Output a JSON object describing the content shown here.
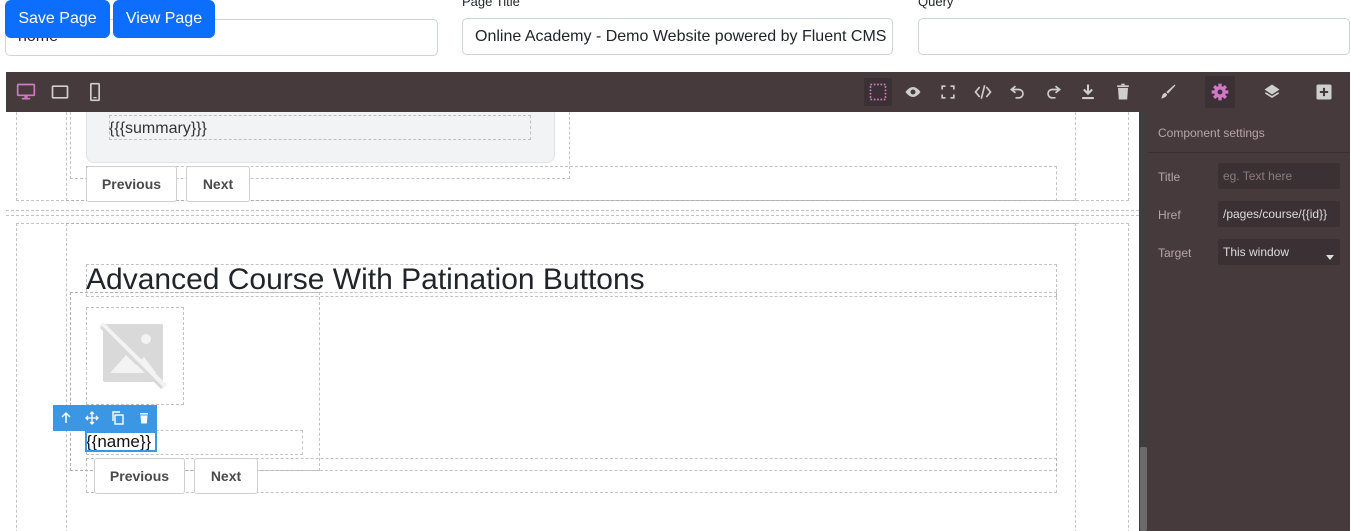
{
  "form": {
    "slug_value": "home",
    "page_title_label": "Page Title",
    "page_title_value": "Online Academy - Demo Website powered by Fluent CMS",
    "query_label": "Query",
    "query_value": ""
  },
  "actions": {
    "save_label": "Save Page",
    "view_label": "View Page"
  },
  "toolbar": {
    "devices": [
      "desktop-icon",
      "tablet-icon",
      "mobile-icon"
    ],
    "commands": [
      "sw-visibility-icon",
      "preview-icon",
      "fullscreen-icon",
      "code-icon",
      "undo-icon",
      "redo-icon",
      "download-icon",
      "trash-icon"
    ],
    "panels": [
      "style-manager-icon",
      "settings-icon",
      "layers-icon",
      "blocks-icon"
    ],
    "accent_color": "#d278c9"
  },
  "settings_panel": {
    "title": "Component settings",
    "traits": {
      "title_label": "Title",
      "title_placeholder": "eg. Text here",
      "href_label": "Href",
      "href_value": "/pages/course/{{id}}",
      "target_label": "Target",
      "target_value": "This window"
    }
  },
  "canvas": {
    "summary_placeholder": "{{{summary}}}",
    "prev_label": "Previous",
    "next_label": "Next",
    "section_heading": "Advanced Course With Patination Buttons",
    "name_placeholder": "{{name}}",
    "prev_label_2": "Previous",
    "next_label_2": "Next"
  },
  "component_toolbar": [
    "arrow-up-icon",
    "move-icon",
    "copy-icon",
    "delete-icon"
  ],
  "colors": {
    "primary_button": "#0d6efd",
    "editor_bg": "#463a3c",
    "selection": "#3b97e3"
  }
}
